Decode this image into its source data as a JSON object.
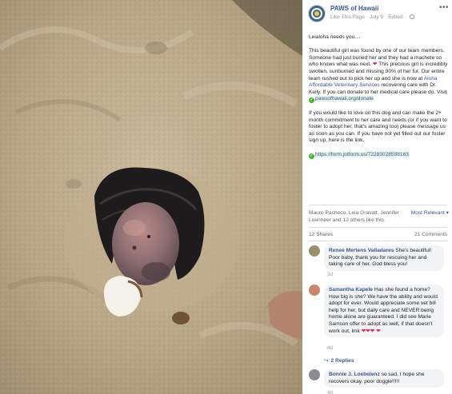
{
  "post": {
    "page_name": "PAWS of Hawaii",
    "like_page": "Like This Page",
    "date": "July 9",
    "edited": "Edited",
    "more_icon": "more-dots-icon",
    "body": {
      "p1": "Leialoha needs you....",
      "p2_a": "This beautiful girl was found by one of our team members. Someone had just buried her and they had a machete so who knows what was next.",
      "p2_b": "This precious girl is incredibly swollen, sunburned and missing 90% of her fur. Our entire team rushed out to pick her up and she is now at",
      "p2_link": "Aloha Affordable Veterinary Services",
      "p2_c": "recovering care with Dr. Kelly. If you can donate to her medical care please do. Visit",
      "donate_link": "pawsofhawaii.org/donate",
      "p3": "If you would like to love on this dog and can make the 2+ month commitment to her care and needs (or if you want to foster to adopt her, that's amazing too) please message us as soon as you can. If you have not yet filled out our foster sign up, here is the link.",
      "form_link": "https://form.jotform.us/72283028599163"
    }
  },
  "engagement": {
    "likes_text": "Mauro Pacheco, Leia Gravatt, Jennifer Loenneer and 12 others like this.",
    "most_relevant": "Most Relevant ▾",
    "shares": "12 Shares",
    "comments": "21 Comments"
  },
  "comments": [
    {
      "author": "Renee Mertens Valladares",
      "text": "She's beautiful! Poor baby, thank you for rescuing her and taking care of her. God bless you!",
      "time": "3d",
      "avatar_color": "#9a8f6a"
    },
    {
      "author": "Samantha Kapele",
      "text": "Has she found a home? How big is she? We have the ability and would adopt for ever. Would appreciate some vet bill help for her, but daily care and NEVER being home alone are guaranteed. I did see Marie Samson offer to adopt as well, if that doesn't work out, lmk",
      "time": "4d",
      "avatar_color": "#c9866a"
    },
    {
      "author": "Bonnie J. Loebelenz",
      "text": "so sad, I hope she recovers okay. poor doggie!!!!!",
      "time": "4d",
      "avatar_color": "#8c8a94"
    }
  ],
  "replies_label": "2 Replies",
  "colors": {
    "link": "#385898",
    "meta": "#90949c",
    "bubble": "#f2f3f5",
    "heart": "#e0245e",
    "check": "#42b72a"
  }
}
